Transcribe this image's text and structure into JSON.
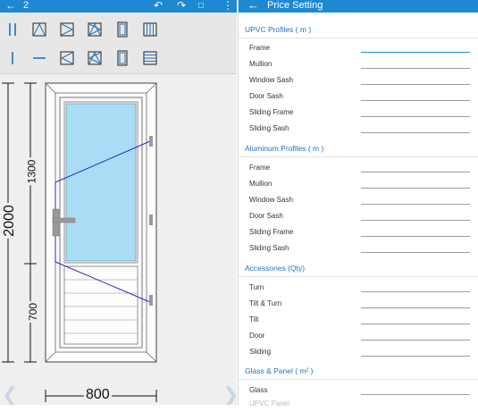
{
  "left_panel": {
    "count": "2",
    "dimensions": {
      "total_height": "2000",
      "upper_height": "1300",
      "lower_height": "700",
      "width": "800"
    }
  },
  "right_panel": {
    "title": "Price Setting",
    "sections": [
      {
        "heading": "UPVC Profiles ( m )",
        "items": [
          "Frame",
          "Mullion",
          "Window Sash",
          "Door Sash",
          "Sliding Frame",
          "Sliding Sash"
        ]
      },
      {
        "heading": "Aluminum Profiles ( m )",
        "items": [
          "Frame",
          "Mullion",
          "Window Sash",
          "Door Sash",
          "Sliding Frame",
          "Sliding Sash"
        ]
      },
      {
        "heading": "Accessories (Qty)",
        "items": [
          "Turn",
          "Tilt & Turn",
          "Tilt",
          "Door",
          "Sliding"
        ]
      },
      {
        "heading": "Glass & Panel ( m² )",
        "items": [
          "Glass",
          "UPVC Panel"
        ]
      }
    ]
  },
  "colors": {
    "accent": "#1e88d0",
    "section_text": "#1e73be",
    "glass": "#a9dcf5"
  }
}
